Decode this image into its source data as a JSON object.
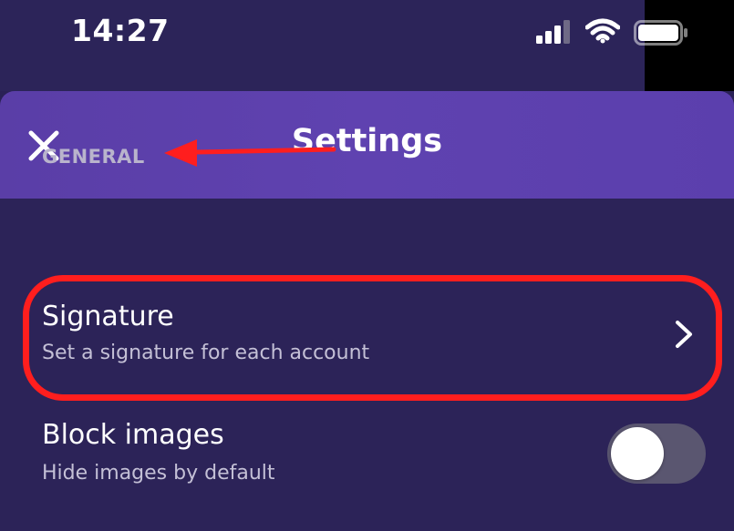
{
  "status_bar": {
    "time": "14:27",
    "icons": [
      "signal-icon",
      "wifi-icon",
      "battery-icon"
    ]
  },
  "header": {
    "title": "Settings",
    "close_icon": "close-icon"
  },
  "sections": [
    {
      "label": "GENERAL",
      "items": [
        {
          "title": "Signature",
          "subtitle": "Set a signature for each account",
          "control": "chevron-right-icon"
        },
        {
          "title": "Block images",
          "subtitle": "Hide images by default",
          "control": "toggle",
          "toggle_on": false
        }
      ]
    }
  ],
  "colors": {
    "background": "#2c2358",
    "header": "#5c40ad",
    "annotation": "#ff1e1e",
    "toggle_off": "#5a5670"
  }
}
